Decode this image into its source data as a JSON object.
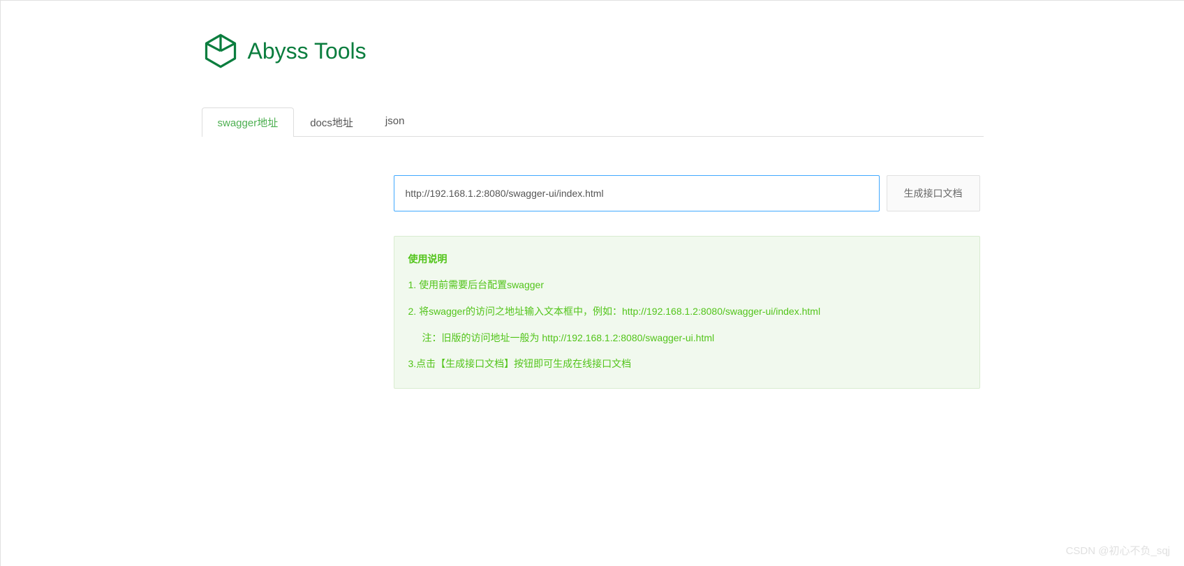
{
  "app": {
    "title": "Abyss Tools"
  },
  "tabs": [
    {
      "label": "swagger地址",
      "active": true
    },
    {
      "label": "docs地址",
      "active": false
    },
    {
      "label": "json",
      "active": false
    }
  ],
  "form": {
    "url_value": "http://192.168.1.2:8080/swagger-ui/index.html",
    "generate_label": "生成接口文档"
  },
  "instructions": {
    "title": "使用说明",
    "items": [
      "1. 使用前需要后台配置swagger",
      "2. 将swagger的访问之地址输入文本框中，例如：http://192.168.1.2:8080/swagger-ui/index.html"
    ],
    "note": "注：旧版的访问地址一般为 http://192.168.1.2:8080/swagger-ui.html",
    "item3": "3.点击【生成接口文档】按钮即可生成在线接口文档"
  },
  "watermark": "CSDN @初心不负_sqj",
  "colors": {
    "primary_green": "#0b7d3e",
    "accent_green": "#52c41a",
    "input_focus": "#40a9ff",
    "instruction_bg": "#f1f9ee"
  }
}
